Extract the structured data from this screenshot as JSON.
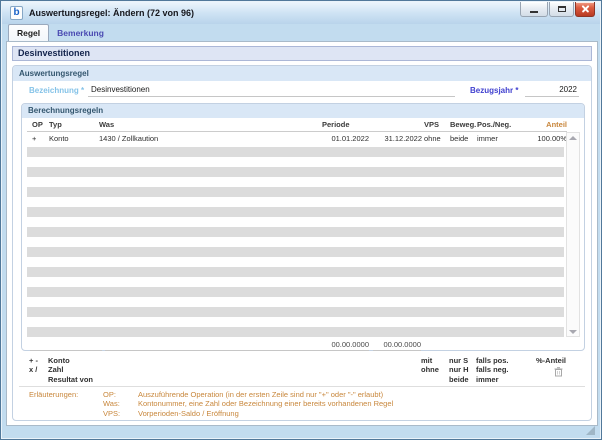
{
  "window": {
    "title": "Auswertungsregel: Ändern (72 von 96)",
    "icon_letter": "b"
  },
  "tabs": [
    {
      "label": "Regel",
      "active": true
    },
    {
      "label": "Bemerkung",
      "active": false
    }
  ],
  "page_header": "Desinvestitionen",
  "auswertungsregel": {
    "title": "Auswertungsregel",
    "bezeichnung_label": "Bezeichnung *",
    "bezeichnung_value": "Desinvestitionen",
    "bezugsjahr_label": "Bezugsjahr *",
    "bezugsjahr_value": "2022"
  },
  "berechnungsregeln": {
    "title": "Berechnungsregeln",
    "columns": {
      "op": "OP",
      "typ": "Typ",
      "was": "Was",
      "periode": "Periode",
      "vps": "VPS",
      "beweg": "Beweg.",
      "pos_neg": "Pos./Neg.",
      "anteil": "Anteil"
    },
    "rows": [
      {
        "op": "+",
        "typ": "Konto",
        "was": "1430 / Zollkaution",
        "periode_von": "01.01.2022",
        "periode_bis": "31.12.2022",
        "vps": "ohne",
        "beweg": "beide",
        "pos_neg": "immer",
        "anteil": "100.00%"
      }
    ],
    "empty_row_count": 19,
    "entry_row": {
      "periode_von_placeholder": "00.00.0000",
      "periode_bis_placeholder": "00.00.0000"
    }
  },
  "legend": {
    "op_lines": [
      "+ -",
      "x /"
    ],
    "was_lines": [
      "Konto",
      "Zahl",
      "Resultat von"
    ],
    "vps_lines": [
      "mit",
      "ohne"
    ],
    "beweg_lines": [
      "nur S",
      "nur H",
      "beide"
    ],
    "pos_neg_lines": [
      "falls pos.",
      "falls neg.",
      "immer"
    ],
    "anteil_label": "%-Anteil"
  },
  "erlaeuterungen": {
    "label": "Erläuterungen:",
    "items": [
      {
        "key": "OP:",
        "text": "Auszuführende Operation (in der ersten Zeile sind nur \"+\" oder \"-\" erlaubt)"
      },
      {
        "key": "Was:",
        "text": "Kontonummer, eine Zahl oder Bezeichnung einer bereits vorhandenen Regel"
      },
      {
        "key": "VPS:",
        "text": "Vorperioden-Saldo / Eröffnung"
      }
    ]
  },
  "colors": {
    "label_light_blue": "#85c3e8",
    "label_blue": "#4040cf",
    "accent_orange": "#c8873c",
    "group_header_bg": "#d9e7f6",
    "stripe_gray": "#dcdcdc",
    "close_button_red": "#b83a22",
    "frame_blue": "#c2dcef"
  }
}
